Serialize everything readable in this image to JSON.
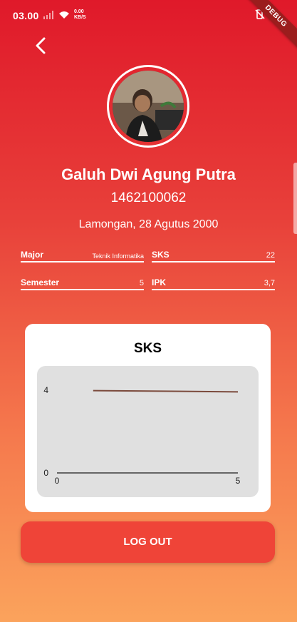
{
  "status_bar": {
    "time": "03.00",
    "net_speed_value": "0.00",
    "net_speed_unit": "KB/S"
  },
  "debug_banner": "DEBUG",
  "profile": {
    "name": "Galuh Dwi Agung Putra",
    "nim": "1462100062",
    "birth": "Lamongan, 28 Agutus 2000"
  },
  "fields": {
    "major": {
      "label": "Major",
      "value": "Teknik Informatika"
    },
    "sks": {
      "label": "SKS",
      "value": "22"
    },
    "semester": {
      "label": "Semester",
      "value": "5"
    },
    "ipk": {
      "label": "IPK",
      "value": "3,7"
    }
  },
  "chart_card": {
    "title": "SKS"
  },
  "chart_data": {
    "type": "line",
    "title": "SKS",
    "x": [
      1,
      5
    ],
    "series": [
      {
        "values": [
          3.98,
          3.92
        ]
      }
    ],
    "xlim": [
      0,
      5
    ],
    "ylim": [
      0,
      4
    ],
    "x_ticks": [
      "0",
      "5"
    ],
    "y_ticks": [
      "0",
      "4"
    ],
    "line_color": "#7b4a3c",
    "grid": false
  },
  "logout_label": "LOG OUT",
  "colors": {
    "gradient_top": "#e0192a",
    "gradient_bottom": "#fba35c",
    "button": "#ef4438"
  }
}
